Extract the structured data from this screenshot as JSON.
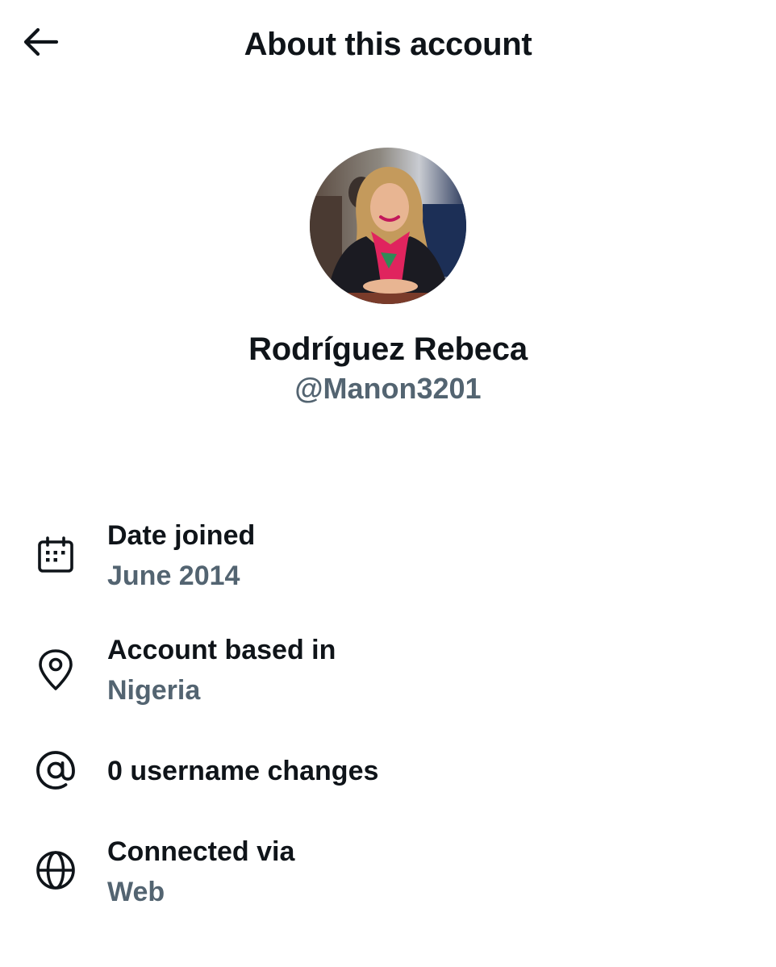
{
  "header": {
    "title": "About this account",
    "back_icon": "arrow-left-icon"
  },
  "profile": {
    "display_name": "Rodríguez Rebeca",
    "handle": "@Manon3201",
    "avatar": "profile-photo"
  },
  "details": {
    "date_joined": {
      "icon": "calendar-icon",
      "label": "Date joined",
      "value": "June 2014"
    },
    "account_based_in": {
      "icon": "location-pin-icon",
      "label": "Account based in",
      "value": "Nigeria"
    },
    "username_changes": {
      "icon": "at-sign-icon",
      "label": "0 username changes"
    },
    "connected_via": {
      "icon": "globe-icon",
      "label": "Connected via",
      "value": "Web"
    }
  },
  "colors": {
    "primary_text": "#0f1419",
    "secondary_text": "#536471",
    "background": "#ffffff"
  }
}
